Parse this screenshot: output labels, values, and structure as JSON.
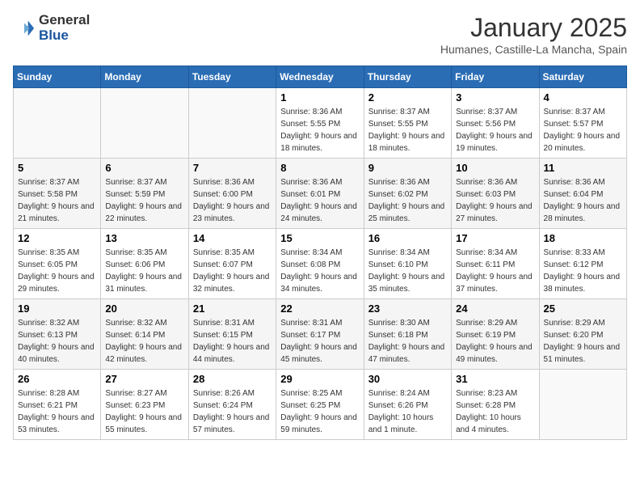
{
  "logo": {
    "general": "General",
    "blue": "Blue"
  },
  "title": "January 2025",
  "location": "Humanes, Castille-La Mancha, Spain",
  "days_of_week": [
    "Sunday",
    "Monday",
    "Tuesday",
    "Wednesday",
    "Thursday",
    "Friday",
    "Saturday"
  ],
  "weeks": [
    [
      {
        "day": null
      },
      {
        "day": null
      },
      {
        "day": null
      },
      {
        "day": "1",
        "sunrise": "8:36 AM",
        "sunset": "5:55 PM",
        "daylight": "9 hours and 18 minutes."
      },
      {
        "day": "2",
        "sunrise": "8:37 AM",
        "sunset": "5:55 PM",
        "daylight": "9 hours and 18 minutes."
      },
      {
        "day": "3",
        "sunrise": "8:37 AM",
        "sunset": "5:56 PM",
        "daylight": "9 hours and 19 minutes."
      },
      {
        "day": "4",
        "sunrise": "8:37 AM",
        "sunset": "5:57 PM",
        "daylight": "9 hours and 20 minutes."
      }
    ],
    [
      {
        "day": "5",
        "sunrise": "8:37 AM",
        "sunset": "5:58 PM",
        "daylight": "9 hours and 21 minutes."
      },
      {
        "day": "6",
        "sunrise": "8:37 AM",
        "sunset": "5:59 PM",
        "daylight": "9 hours and 22 minutes."
      },
      {
        "day": "7",
        "sunrise": "8:36 AM",
        "sunset": "6:00 PM",
        "daylight": "9 hours and 23 minutes."
      },
      {
        "day": "8",
        "sunrise": "8:36 AM",
        "sunset": "6:01 PM",
        "daylight": "9 hours and 24 minutes."
      },
      {
        "day": "9",
        "sunrise": "8:36 AM",
        "sunset": "6:02 PM",
        "daylight": "9 hours and 25 minutes."
      },
      {
        "day": "10",
        "sunrise": "8:36 AM",
        "sunset": "6:03 PM",
        "daylight": "9 hours and 27 minutes."
      },
      {
        "day": "11",
        "sunrise": "8:36 AM",
        "sunset": "6:04 PM",
        "daylight": "9 hours and 28 minutes."
      }
    ],
    [
      {
        "day": "12",
        "sunrise": "8:35 AM",
        "sunset": "6:05 PM",
        "daylight": "9 hours and 29 minutes."
      },
      {
        "day": "13",
        "sunrise": "8:35 AM",
        "sunset": "6:06 PM",
        "daylight": "9 hours and 31 minutes."
      },
      {
        "day": "14",
        "sunrise": "8:35 AM",
        "sunset": "6:07 PM",
        "daylight": "9 hours and 32 minutes."
      },
      {
        "day": "15",
        "sunrise": "8:34 AM",
        "sunset": "6:08 PM",
        "daylight": "9 hours and 34 minutes."
      },
      {
        "day": "16",
        "sunrise": "8:34 AM",
        "sunset": "6:10 PM",
        "daylight": "9 hours and 35 minutes."
      },
      {
        "day": "17",
        "sunrise": "8:34 AM",
        "sunset": "6:11 PM",
        "daylight": "9 hours and 37 minutes."
      },
      {
        "day": "18",
        "sunrise": "8:33 AM",
        "sunset": "6:12 PM",
        "daylight": "9 hours and 38 minutes."
      }
    ],
    [
      {
        "day": "19",
        "sunrise": "8:32 AM",
        "sunset": "6:13 PM",
        "daylight": "9 hours and 40 minutes."
      },
      {
        "day": "20",
        "sunrise": "8:32 AM",
        "sunset": "6:14 PM",
        "daylight": "9 hours and 42 minutes."
      },
      {
        "day": "21",
        "sunrise": "8:31 AM",
        "sunset": "6:15 PM",
        "daylight": "9 hours and 44 minutes."
      },
      {
        "day": "22",
        "sunrise": "8:31 AM",
        "sunset": "6:17 PM",
        "daylight": "9 hours and 45 minutes."
      },
      {
        "day": "23",
        "sunrise": "8:30 AM",
        "sunset": "6:18 PM",
        "daylight": "9 hours and 47 minutes."
      },
      {
        "day": "24",
        "sunrise": "8:29 AM",
        "sunset": "6:19 PM",
        "daylight": "9 hours and 49 minutes."
      },
      {
        "day": "25",
        "sunrise": "8:29 AM",
        "sunset": "6:20 PM",
        "daylight": "9 hours and 51 minutes."
      }
    ],
    [
      {
        "day": "26",
        "sunrise": "8:28 AM",
        "sunset": "6:21 PM",
        "daylight": "9 hours and 53 minutes."
      },
      {
        "day": "27",
        "sunrise": "8:27 AM",
        "sunset": "6:23 PM",
        "daylight": "9 hours and 55 minutes."
      },
      {
        "day": "28",
        "sunrise": "8:26 AM",
        "sunset": "6:24 PM",
        "daylight": "9 hours and 57 minutes."
      },
      {
        "day": "29",
        "sunrise": "8:25 AM",
        "sunset": "6:25 PM",
        "daylight": "9 hours and 59 minutes."
      },
      {
        "day": "30",
        "sunrise": "8:24 AM",
        "sunset": "6:26 PM",
        "daylight": "10 hours and 1 minute."
      },
      {
        "day": "31",
        "sunrise": "8:23 AM",
        "sunset": "6:28 PM",
        "daylight": "10 hours and 4 minutes."
      },
      {
        "day": null
      }
    ]
  ],
  "labels": {
    "sunrise": "Sunrise:",
    "sunset": "Sunset:",
    "daylight": "Daylight:"
  }
}
